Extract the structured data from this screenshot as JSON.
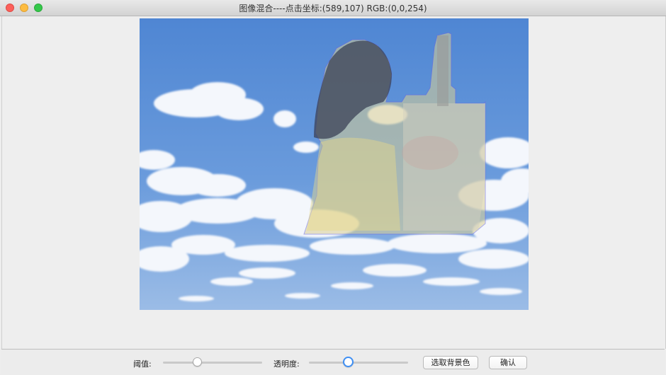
{
  "window": {
    "title": "图像混合----点击坐标:(589,107) RGB:(0,0,254)"
  },
  "controls": {
    "threshold_label": "阈值:",
    "threshold_value": 0.33,
    "opacity_label": "透明度:",
    "opacity_value": 0.38,
    "select_bg_button": "选取背景色",
    "confirm_button": "确认"
  },
  "colors": {
    "sky": "#5b8fd6",
    "focus_ring": "#3f8ff3"
  }
}
